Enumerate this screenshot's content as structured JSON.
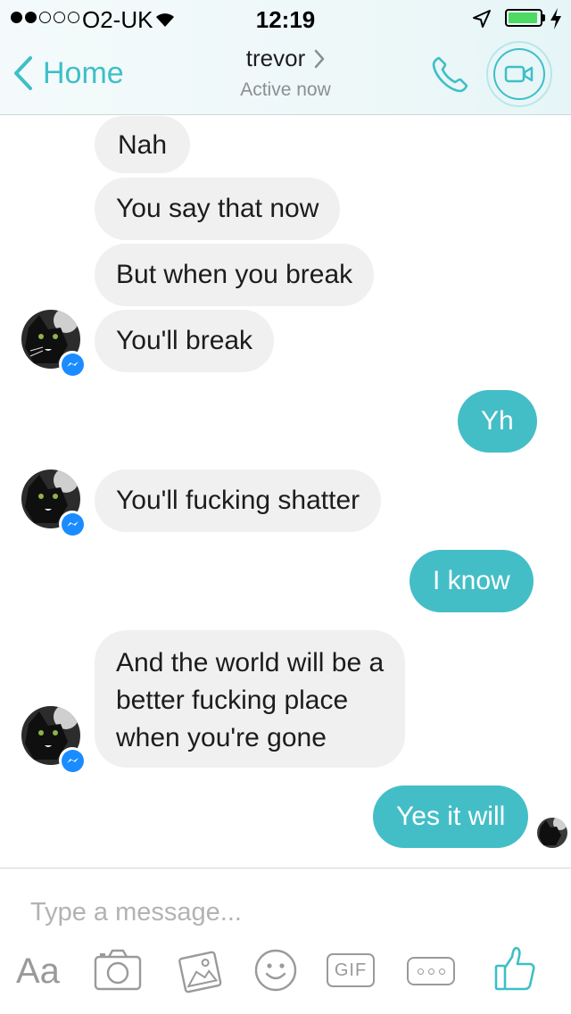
{
  "status_bar": {
    "carrier": "O2-UK",
    "time": "12:19",
    "signal_bars_filled": 2,
    "signal_bars_total": 5,
    "battery_level": 0.85
  },
  "header": {
    "back_label": "Home",
    "contact_name": "trevor",
    "presence": "Active now",
    "accent_color": "#3ebfc7"
  },
  "messages": [
    {
      "direction": "incoming",
      "text": "Nah"
    },
    {
      "direction": "incoming",
      "text": "You say that now"
    },
    {
      "direction": "incoming",
      "text": "But when you break"
    },
    {
      "direction": "incoming",
      "text": "You'll break"
    },
    {
      "direction": "outgoing",
      "text": "Yh"
    },
    {
      "direction": "incoming",
      "text": "You'll fucking shatter"
    },
    {
      "direction": "outgoing",
      "text": "I know"
    },
    {
      "direction": "incoming",
      "lines": [
        "And the world will be a",
        "better fucking place",
        "when you're gone"
      ]
    },
    {
      "direction": "outgoing",
      "text": "Yes it will"
    }
  ],
  "composer": {
    "placeholder": "Type a message...",
    "text_tool_label": "Aa",
    "gif_label": "GIF",
    "tools": [
      "text-icon",
      "camera-icon",
      "photo-icon",
      "emoji-icon",
      "gif-icon",
      "more-icon",
      "like-icon"
    ]
  },
  "colors": {
    "incoming_bubble": "#f1f0f0",
    "outgoing_bubble": "#44bec6",
    "messenger_badge": "#1a8cff"
  }
}
